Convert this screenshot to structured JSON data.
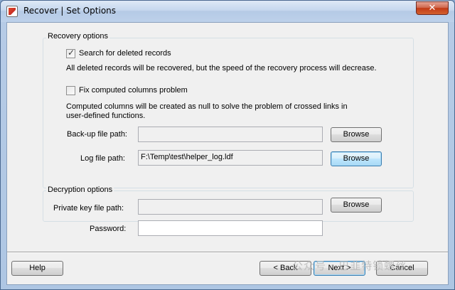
{
  "window": {
    "title": "Recover | Set Options",
    "close_glyph": "✕",
    "icon": "app-logo-icon"
  },
  "recovery_group": {
    "label": "Recovery options",
    "search_deleted": {
      "label": "Search for deleted records",
      "checked": true,
      "description": "All deleted records will be recovered, but the speed of the recovery process will decrease."
    },
    "fix_computed": {
      "label": "Fix computed columns problem",
      "checked": false,
      "description": "Computed columns will be created as null to solve the problem of crossed links in user-defined functions."
    },
    "backup_path": {
      "label": "Back-up file path:",
      "value": "",
      "browse_label": "Browse"
    },
    "log_path": {
      "label": "Log file path:",
      "value": "F:\\Temp\\test\\helper_log.ldf",
      "browse_label": "Browse"
    }
  },
  "decryption_group": {
    "label": "Decryption options",
    "private_key": {
      "label": "Private key file path:",
      "value": "",
      "browse_label": "Browse"
    },
    "password": {
      "label": "Password:",
      "value": ""
    }
  },
  "footer": {
    "help_label": "Help",
    "back_label": "< Back",
    "next_label": "Next >",
    "cancel_label": "Cancel"
  },
  "watermark": {
    "text": "公众号 · 巴韭特锁螺丝"
  },
  "check_glyph": "✓"
}
